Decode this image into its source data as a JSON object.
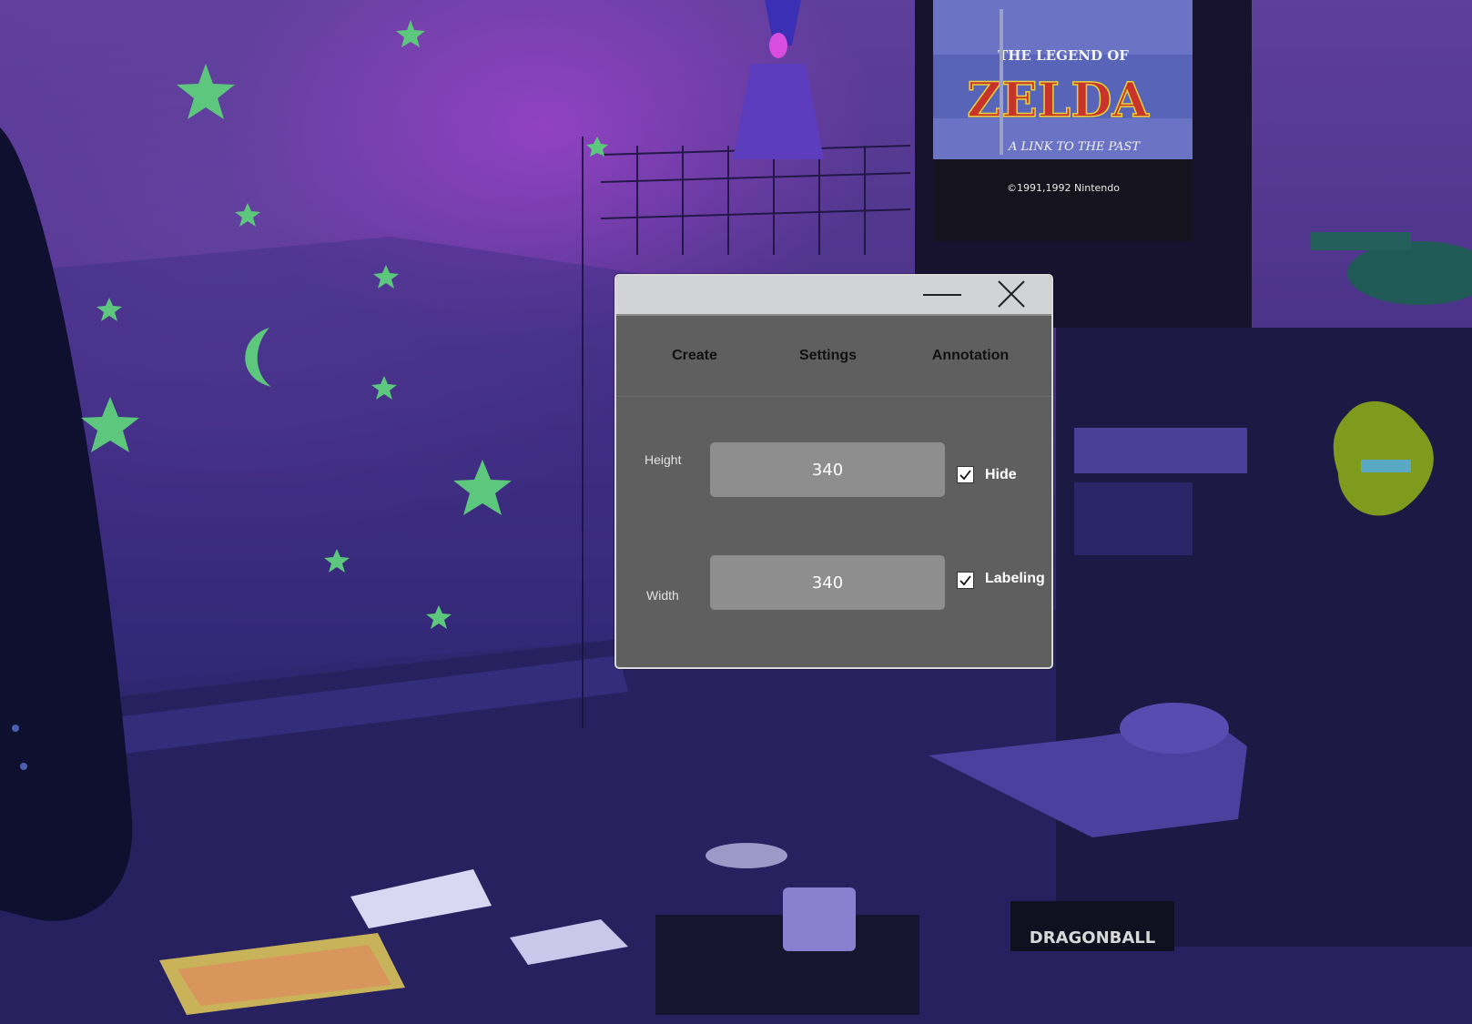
{
  "window": {
    "minimize_label": "Minimize",
    "close_label": "Close"
  },
  "tabs": [
    {
      "label": "Create"
    },
    {
      "label": "Settings"
    },
    {
      "label": "Annotation"
    }
  ],
  "form": {
    "height": {
      "label": "Height",
      "value": "340"
    },
    "width": {
      "label": "Width",
      "value": "340"
    },
    "hide": {
      "label": "Hide",
      "checked": true
    },
    "labeling": {
      "label": "Labeling",
      "checked": true
    }
  },
  "background": {
    "tv_screen": {
      "title_line1": "THE LEGEND OF",
      "title_main": "ZELDA",
      "subtitle": "A LINK TO THE PAST",
      "copyright": "©1991,1992 Nintendo"
    },
    "vhs_label": "DRAGONBALL"
  },
  "colors": {
    "window_bg": "#5f5f5f",
    "titlebar_bg": "#d2d3d5",
    "input_bg": "#8e8e8e",
    "star_green": "#5ec77e"
  }
}
